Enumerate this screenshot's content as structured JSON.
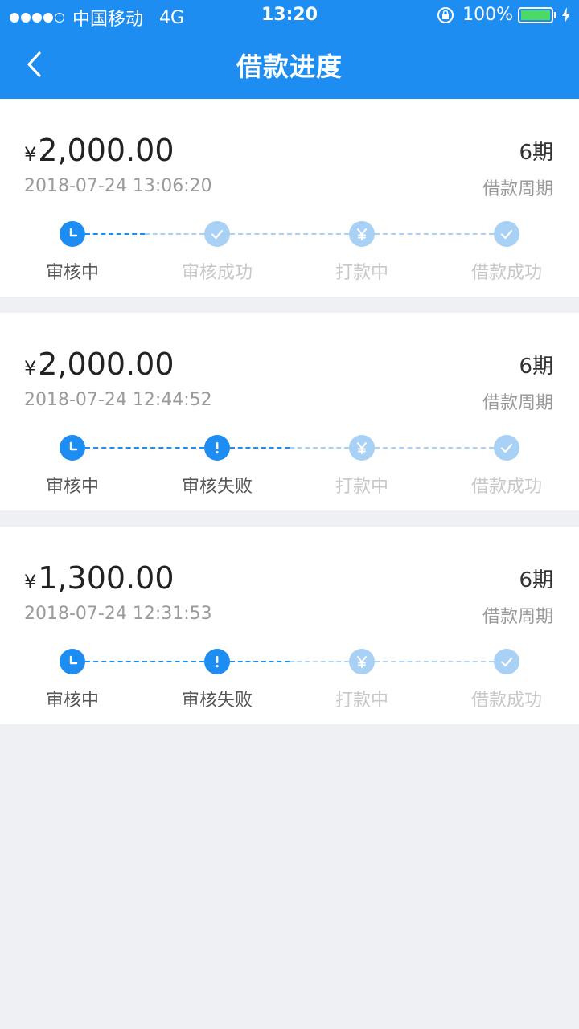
{
  "status_bar": {
    "carrier": "中国移动",
    "network": "4G",
    "time": "13:20",
    "battery": "100%"
  },
  "nav": {
    "title": "借款进度",
    "back_icon": "chevron-left-icon"
  },
  "colors": {
    "primary": "#1e8df1",
    "inactive": "#a9d0f5",
    "background": "#eff0f4"
  },
  "loans": [
    {
      "currency": "¥",
      "amount": "2,000.00",
      "datetime": "2018-07-24 13:06:20",
      "period": "6期",
      "period_label": "借款周期",
      "steps": [
        {
          "label": "审核中",
          "icon": "clock-icon",
          "active": true
        },
        {
          "label": "审核成功",
          "icon": "check-icon",
          "active": false
        },
        {
          "label": "打款中",
          "icon": "yen-icon",
          "active": false
        },
        {
          "label": "借款成功",
          "icon": "check-icon",
          "active": false
        }
      ]
    },
    {
      "currency": "¥",
      "amount": "2,000.00",
      "datetime": "2018-07-24 12:44:52",
      "period": "6期",
      "period_label": "借款周期",
      "steps": [
        {
          "label": "审核中",
          "icon": "clock-icon",
          "active": true
        },
        {
          "label": "审核失败",
          "icon": "exclamation-icon",
          "active": true
        },
        {
          "label": "打款中",
          "icon": "yen-icon",
          "active": false
        },
        {
          "label": "借款成功",
          "icon": "check-icon",
          "active": false
        }
      ]
    },
    {
      "currency": "¥",
      "amount": "1,300.00",
      "datetime": "2018-07-24 12:31:53",
      "period": "6期",
      "period_label": "借款周期",
      "steps": [
        {
          "label": "审核中",
          "icon": "clock-icon",
          "active": true
        },
        {
          "label": "审核失败",
          "icon": "exclamation-icon",
          "active": true
        },
        {
          "label": "打款中",
          "icon": "yen-icon",
          "active": false
        },
        {
          "label": "借款成功",
          "icon": "check-icon",
          "active": false
        }
      ]
    }
  ]
}
